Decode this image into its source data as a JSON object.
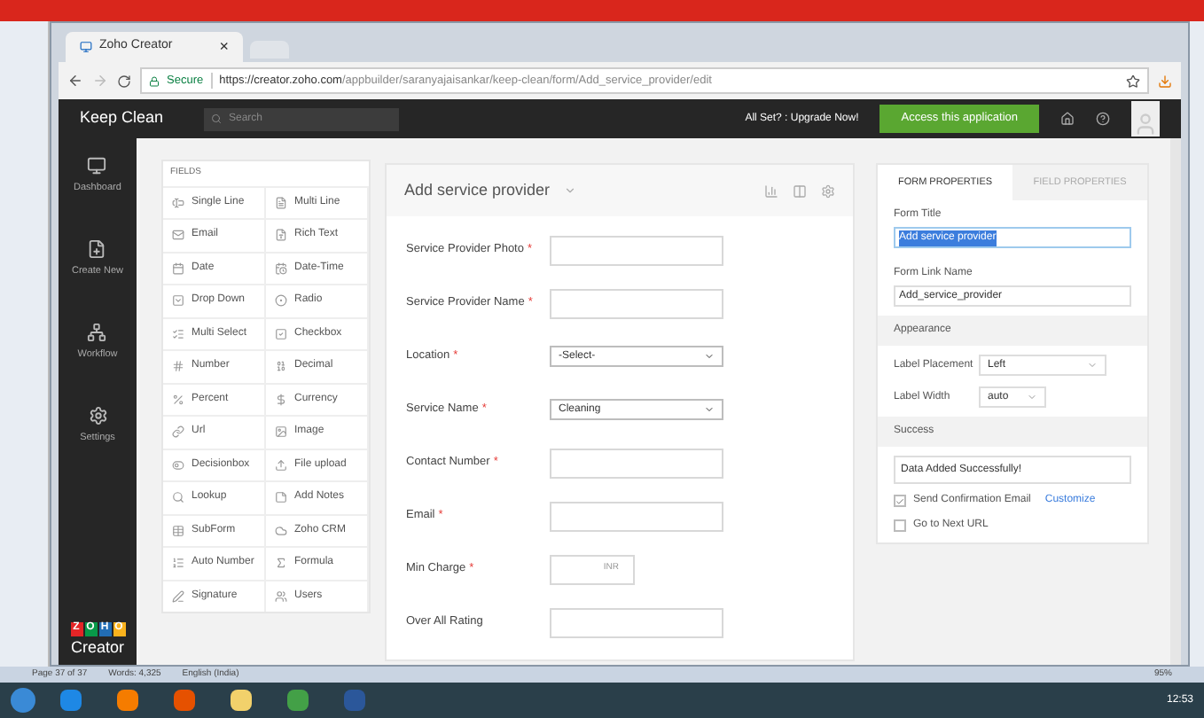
{
  "browser": {
    "tab": {
      "title": "Zoho Creator",
      "close": "×"
    },
    "address": {
      "secure": "Secure",
      "url_host": "https://creator.zoho.com",
      "url_path": "/appbuilder/saranyajaisankar/keep-clean/form/Add_service_provider/edit"
    }
  },
  "app": {
    "name": "Keep Clean",
    "search": {
      "placeholder": "Search"
    },
    "upgrade": "All Set? : Upgrade Now!",
    "access_button": "Access this application"
  },
  "sidebar": {
    "items": [
      {
        "label": "Dashboard"
      },
      {
        "label": "Create New"
      },
      {
        "label": "Workflow"
      },
      {
        "label": "Settings"
      }
    ],
    "logo": {
      "letters": [
        {
          "char": "Z",
          "color": "#e42527"
        },
        {
          "char": "O",
          "color": "#089949"
        },
        {
          "char": "H",
          "color": "#226db4"
        },
        {
          "char": "O",
          "color": "#f9b21d"
        }
      ],
      "product": "Creator"
    }
  },
  "fields_panel": {
    "heading": "FIELDS",
    "items": [
      {
        "label": "Single Line"
      },
      {
        "label": "Multi Line"
      },
      {
        "label": "Email"
      },
      {
        "label": "Rich Text"
      },
      {
        "label": "Date"
      },
      {
        "label": "Date-Time"
      },
      {
        "label": "Drop Down"
      },
      {
        "label": "Radio"
      },
      {
        "label": "Multi Select"
      },
      {
        "label": "Checkbox"
      },
      {
        "label": "Number"
      },
      {
        "label": "Decimal"
      },
      {
        "label": "Percent"
      },
      {
        "label": "Currency"
      },
      {
        "label": "Url"
      },
      {
        "label": "Image"
      },
      {
        "label": "Decisionbox"
      },
      {
        "label": "File upload"
      },
      {
        "label": "Lookup"
      },
      {
        "label": "Add Notes"
      },
      {
        "label": "SubForm"
      },
      {
        "label": "Zoho CRM"
      },
      {
        "label": "Auto Number"
      },
      {
        "label": "Formula"
      },
      {
        "label": "Signature"
      },
      {
        "label": "Users"
      }
    ]
  },
  "form": {
    "title": "Add service provider",
    "required_mark": "*",
    "fields": [
      {
        "label": "Service Provider Photo",
        "required": true,
        "kind": "text"
      },
      {
        "label": "Service Provider Name",
        "required": true,
        "kind": "text"
      },
      {
        "label": "Location",
        "required": true,
        "kind": "select",
        "value": "-Select-"
      },
      {
        "label": "Service Name",
        "required": true,
        "kind": "select",
        "value": "Cleaning"
      },
      {
        "label": "Contact Number",
        "required": true,
        "kind": "text"
      },
      {
        "label": "Email",
        "required": true,
        "kind": "text"
      },
      {
        "label": "Min Charge",
        "required": true,
        "kind": "currency",
        "suffix": "INR"
      },
      {
        "label": "Over All Rating",
        "required": false,
        "kind": "text"
      }
    ]
  },
  "properties": {
    "tabs": [
      {
        "label": "FORM PROPERTIES",
        "selected": true
      },
      {
        "label": "FIELD PROPERTIES",
        "selected": false
      }
    ],
    "form_title": {
      "label": "Form Title",
      "value": "Add service provider",
      "text_selected": true
    },
    "form_link_name": {
      "label": "Form Link Name",
      "value": "Add_service_provider"
    },
    "appearance": {
      "heading": "Appearance",
      "label_placement": {
        "label": "Label Placement",
        "value": "Left"
      },
      "label_width": {
        "label": "Label Width",
        "value": "auto"
      }
    },
    "success": {
      "heading": "Success",
      "message": "Data Added Successfully!",
      "options": [
        {
          "label": "Send Confirmation Email",
          "checked": true,
          "link": "Customize"
        },
        {
          "label": "Go to Next URL",
          "checked": false
        }
      ]
    }
  },
  "word": {
    "status": [
      "Page 37 of 37",
      "Words: 4,325",
      "English (India)"
    ],
    "zoom": "95%"
  },
  "taskbar": {
    "time": "12:53"
  }
}
